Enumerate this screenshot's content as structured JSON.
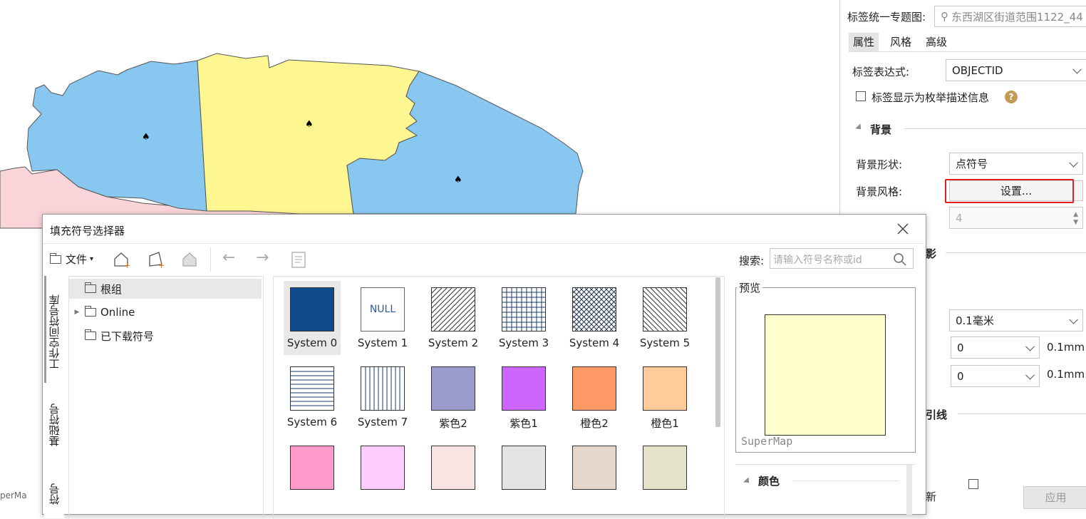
{
  "map": {
    "colors": {
      "blue": "#88c8f0",
      "yellow": "#fdf691",
      "pink": "#f9d5da",
      "border": "#555555"
    },
    "marker_icon": "spade-marker-icon",
    "corner_text": "perMa"
  },
  "right_panel": {
    "title_label": "标签统一专题图:",
    "title_value": "东西湖区街道范围1122_44",
    "tabs": [
      "属性",
      "风格",
      "高级"
    ],
    "active_tab": "属性",
    "expr_label": "标签表达式:",
    "expr_value": "OBJECTID",
    "enum_checkbox_label": "标签显示为枚举描述信息",
    "background_section": "背景",
    "bg_shape_label": "背景形状:",
    "bg_shape_value": "点符号",
    "bg_style_label": "背景风格:",
    "bg_style_button": "设置...",
    "partial_value": "4",
    "partial_shadow_label": "影",
    "line_width_value": "0.1毫米",
    "offset_x_value": "0",
    "offset_y_value": "0",
    "unit_x": "0.1mm",
    "unit_y": "0.1mm",
    "partial_leader_label": "引线",
    "partial_bottom_label": "新",
    "apply_button": "应用",
    "highlight_color": "#e02020"
  },
  "dialog": {
    "title": "填充符号选择器",
    "file_menu": "文件",
    "search_label": "搜索:",
    "search_placeholder": "请输入符号名称或id",
    "vtabs": [
      "工作空间符号库",
      "基础符号",
      "符号"
    ],
    "tree": [
      {
        "label": "根组",
        "selected": true,
        "expandable": false
      },
      {
        "label": "Online",
        "selected": false,
        "expandable": true
      },
      {
        "label": "已下载符号",
        "selected": false,
        "expandable": false
      }
    ],
    "symbols": [
      {
        "label": "System 0",
        "kind": "solid",
        "color": "#0e4a8c",
        "selected": true
      },
      {
        "label": "System 1",
        "kind": "null",
        "text": "NULL",
        "color": "#ffffff"
      },
      {
        "label": "System 2",
        "kind": "diag",
        "color": "#ffffff"
      },
      {
        "label": "System 3",
        "kind": "grid",
        "color": "#ffffff"
      },
      {
        "label": "System 4",
        "kind": "cross",
        "color": "#ffffff"
      },
      {
        "label": "System 5",
        "kind": "backdiag",
        "color": "#ffffff"
      },
      {
        "label": "System 6",
        "kind": "hlines",
        "color": "#ffffff"
      },
      {
        "label": "System 7",
        "kind": "vlines",
        "color": "#ffffff"
      },
      {
        "label": "紫色2",
        "kind": "solid",
        "color": "#9a9acb"
      },
      {
        "label": "紫色1",
        "kind": "solid",
        "color": "#cc66ff"
      },
      {
        "label": "橙色2",
        "kind": "solid",
        "color": "#ff9966"
      },
      {
        "label": "橙色1",
        "kind": "solid",
        "color": "#ffcc99"
      },
      {
        "label": "",
        "kind": "solid",
        "color": "#ff99cc"
      },
      {
        "label": "",
        "kind": "solid",
        "color": "#ffccff"
      },
      {
        "label": "",
        "kind": "solid",
        "color": "#f9e4e4"
      },
      {
        "label": "",
        "kind": "solid",
        "color": "#e4e4e4"
      },
      {
        "label": "",
        "kind": "solid",
        "color": "#e4d6cb"
      },
      {
        "label": "",
        "kind": "solid",
        "color": "#e4e2cb"
      }
    ],
    "preview_label": "预览",
    "preview_color": "#ffffcc",
    "preview_watermark": "SuperMap",
    "color_section": "颜色"
  }
}
